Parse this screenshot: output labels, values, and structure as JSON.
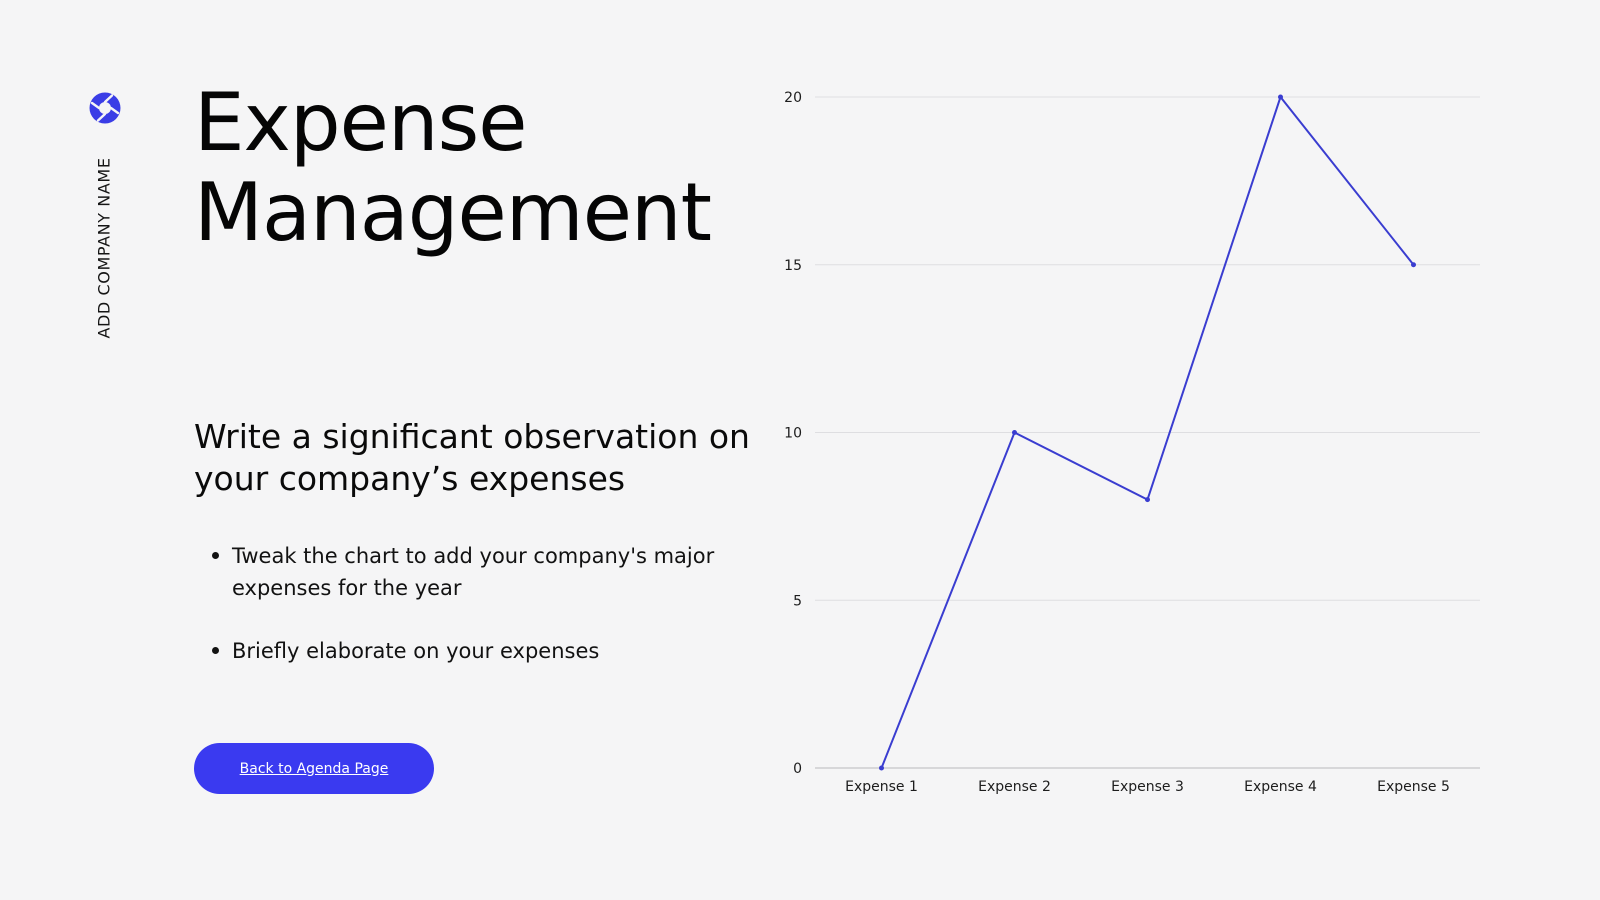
{
  "brand": {
    "company_name": "ADD COMPANY NAME",
    "logo_icon": "aperture-icon",
    "accent_color": "#3a3de6"
  },
  "slide": {
    "title": "Expense Management",
    "subtitle": "Write a significant observation on your company’s expenses",
    "bullets": [
      "Tweak the chart to add your company's major expenses for the year",
      "Briefly elaborate on your expenses"
    ],
    "back_button_label": "Back to Agenda Page",
    "button_color": "#3a3af0"
  },
  "chart_data": {
    "type": "line",
    "categories": [
      "Expense 1",
      "Expense 2",
      "Expense 3",
      "Expense 4",
      "Expense 5"
    ],
    "series": [
      {
        "values": [
          0,
          10,
          8,
          20,
          15
        ],
        "color": "#3a3dd0"
      }
    ],
    "ylim": [
      0,
      20
    ],
    "yticks": [
      0,
      5,
      10,
      15,
      20
    ],
    "grid": true,
    "legend": "none"
  }
}
